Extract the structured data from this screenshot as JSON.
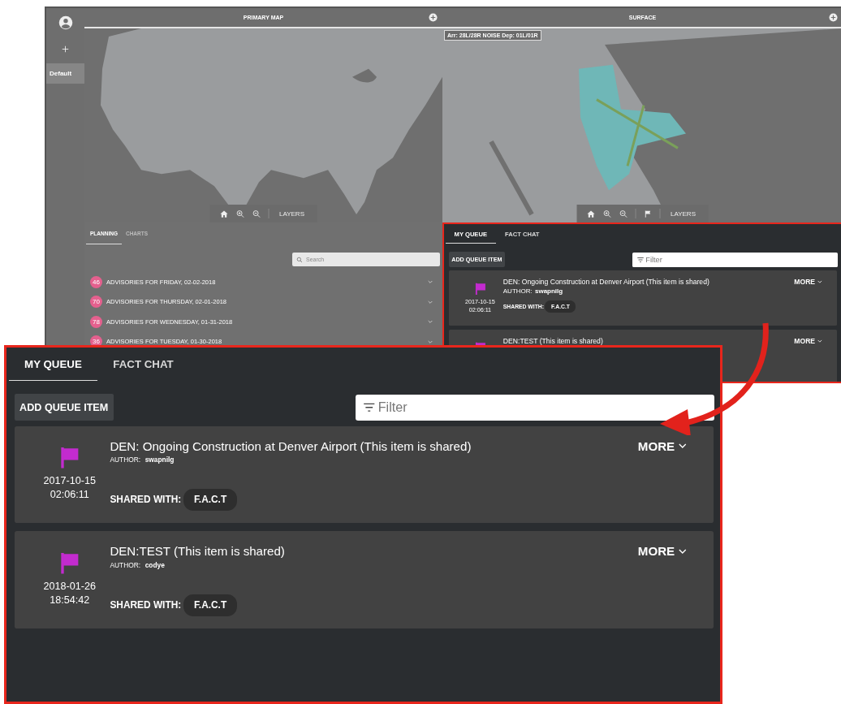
{
  "sidebar": {
    "items": [
      {
        "label": "Default",
        "selected": true
      }
    ]
  },
  "maps": [
    {
      "title": "PRIMARY MAP",
      "kind": "national",
      "layers": "LAYERS"
    },
    {
      "title": "SURFACE",
      "kind": "airport",
      "overlay_label": "Arr: 28L/28R NOISE Dep: 01L/01R",
      "layers": "LAYERS"
    }
  ],
  "planning": {
    "tabs": [
      {
        "label": "PLANNING",
        "selected": true
      },
      {
        "label": "CHARTS",
        "selected": false
      }
    ],
    "search": {
      "placeholder": "Search"
    },
    "items": [
      {
        "badge": "46",
        "label": "ADVISORIES FOR FRIDAY, 02-02-2018"
      },
      {
        "badge": "70",
        "label": "ADVISORIES FOR THURSDAY, 02-01-2018"
      },
      {
        "badge": "78",
        "label": "ADVISORIES FOR WEDNESDAY, 01-31-2018"
      },
      {
        "badge": "36",
        "label": "ADVISORIES FOR TUESDAY, 01-30-2018"
      }
    ]
  },
  "queue_panel": {
    "tabs": [
      {
        "label": "MY QUEUE",
        "selected": true
      },
      {
        "label": "FACT CHAT",
        "selected": false
      }
    ],
    "add_button": "ADD QUEUE ITEM",
    "filter": {
      "placeholder": "Filter"
    },
    "items": [
      {
        "title": "DEN: Ongoing Construction at Denver Airport (This item is shared)",
        "author_label": "AUTHOR:",
        "author": "swapnilg",
        "date": "2017-10-15",
        "time": "02:06:11",
        "shared_label": "SHARED WITH:",
        "shared_with": "F.A.C.T",
        "more": "MORE"
      },
      {
        "title": "DEN:TEST (This item is shared)",
        "more": "MORE"
      }
    ]
  },
  "callout": {
    "tabs": [
      {
        "label": "MY QUEUE",
        "selected": true
      },
      {
        "label": "FACT CHAT",
        "selected": false
      }
    ],
    "add_button": "ADD QUEUE ITEM",
    "filter": {
      "placeholder": "Filter"
    },
    "items": [
      {
        "title": "DEN: Ongoing Construction at Denver Airport (This item is shared)",
        "author_label": "AUTHOR:",
        "author": "swapnilg",
        "date": "2017-10-15",
        "time": "02:06:11",
        "shared_label": "SHARED WITH:",
        "shared_with": "F.A.C.T",
        "more": "MORE"
      },
      {
        "title": "DEN:TEST (This item is shared)",
        "author_label": "AUTHOR:",
        "author": "codye",
        "date": "2018-01-26",
        "time": "18:54:42",
        "shared_label": "SHARED WITH:",
        "shared_with": "F.A.C.T",
        "more": "MORE"
      }
    ]
  }
}
